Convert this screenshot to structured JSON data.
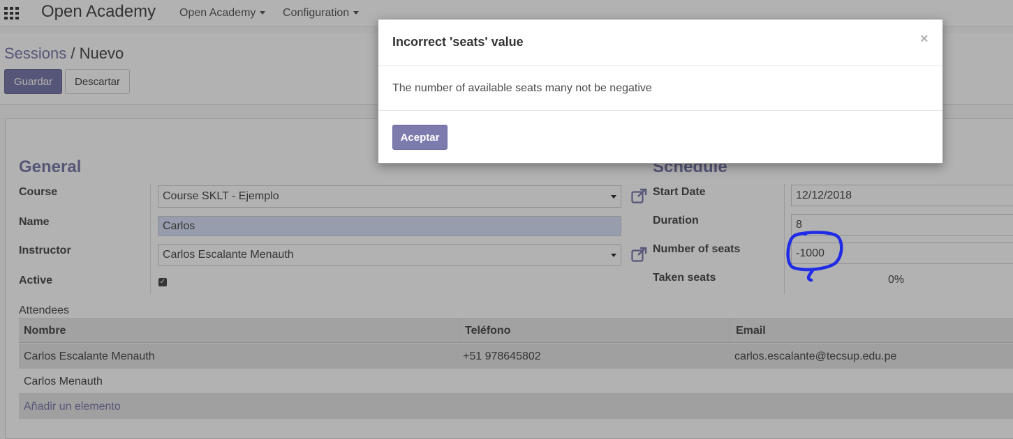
{
  "navbar": {
    "brand": "Open Academy",
    "menus": [
      {
        "label": "Open Academy"
      },
      {
        "label": "Configuration"
      }
    ]
  },
  "breadcrumb": {
    "parent": "Sessions",
    "separator": "/",
    "current": "Nuevo"
  },
  "toolbar": {
    "save_label": "Guardar",
    "discard_label": "Descartar"
  },
  "form": {
    "general": {
      "title": "General",
      "course_label": "Course",
      "course_value": "Course SKLT - Ejemplo",
      "name_label": "Name",
      "name_value": "Carlos",
      "instructor_label": "Instructor",
      "instructor_value": "Carlos Escalante Menauth",
      "active_label": "Active",
      "active_checked": true
    },
    "schedule": {
      "title": "Schedule",
      "start_date_label": "Start Date",
      "start_date_value": "12/12/2018",
      "duration_label": "Duration",
      "duration_value": "8",
      "seats_label": "Number of seats",
      "seats_value": "-1000",
      "taken_seats_label": "Taken seats",
      "taken_seats_value": "0%"
    }
  },
  "attendees": {
    "label": "Attendees",
    "columns": [
      "Nombre",
      "Teléfono",
      "Email"
    ],
    "rows": [
      [
        "Carlos Escalante Menauth",
        "+51 978645802",
        "carlos.escalante@tecsup.edu.pe"
      ],
      [
        "Carlos Menauth",
        "",
        ""
      ]
    ],
    "add_label": "Añadir un elemento"
  },
  "modal": {
    "title": "Incorrect 'seats' value",
    "close_glyph": "×",
    "message": "The number of available seats many not be negative",
    "ok_label": "Aceptar"
  },
  "colors": {
    "accent": "#7c7bad",
    "annotation": "#1f2be6"
  }
}
